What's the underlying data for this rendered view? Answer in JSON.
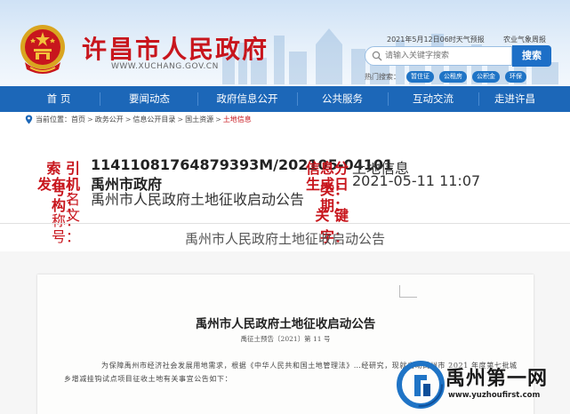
{
  "header": {
    "title": "许昌市人民政府",
    "domain": "WWW.XUCHANG.GOV.CN",
    "date_weather": "2021年5月12日06时天气预报",
    "weather_source": "农业气象周报",
    "search": {
      "placeholder": "请输入关键字搜索",
      "button": "搜索"
    },
    "hot_label": "热门搜索：",
    "hot_tags": [
      "暂住证",
      "公租房",
      "公积金",
      "环保"
    ]
  },
  "nav": {
    "items": [
      {
        "label": "首 页"
      },
      {
        "label": "要闻动态"
      },
      {
        "label": "政府信息公开"
      },
      {
        "label": "公共服务"
      },
      {
        "label": "互动交流"
      },
      {
        "label": "走进许昌"
      }
    ]
  },
  "breadcrumb": {
    "prefix": "当前位置：",
    "items": [
      "首页",
      "政务公开",
      "信息公开目录",
      "国土资源",
      "土地信息"
    ],
    "separator": ">"
  },
  "info": {
    "index_label": "索 引 号：",
    "index_value": "11411081764879393M/202105-04101",
    "publisher_label": "发布机构：",
    "publisher_value": "禹州市政府",
    "name_label": "名　　称：",
    "name_value": "禹州市人民政府土地征收启动公告",
    "docno_label": "文　　号：",
    "docno_value": "",
    "category_label": "信息分类：",
    "category_value": "土地信息",
    "date_label": "生成日期：",
    "date_value": "2021-05-11 11:07",
    "keyword_label": "关 键 字：",
    "keyword_value": ""
  },
  "page_title": "禹州市人民政府土地征收启动公告",
  "document": {
    "title": "禹州市人民政府土地征收启动公告",
    "number": "禹征土预告〔2021〕第 11 号",
    "paragraph": "为保障禹州市经济社会发展用地需求，根据《中华人民共和国土地管理法》…经研究，现就启动禹州市 2021 年度第七批城乡增减挂钩试点项目征收土地有关事宜公告如下："
  },
  "watermark": {
    "name": "禹州第一网",
    "url": "www.yuzhoufirst.com"
  },
  "colors": {
    "nav_bg": "#1c67b8",
    "accent_red": "#c8161d",
    "search_button": "#1d6fc7"
  }
}
